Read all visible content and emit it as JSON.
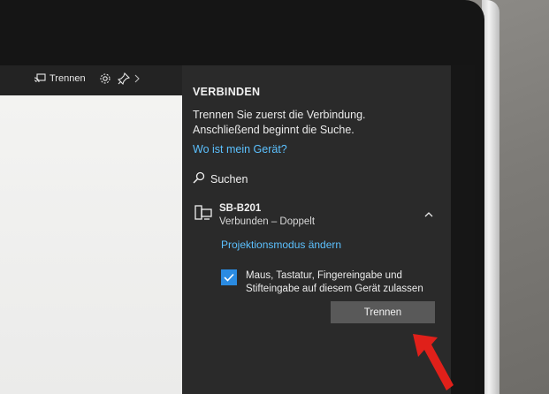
{
  "app_bar": {
    "disconnect_label": "Trennen"
  },
  "connect_pane": {
    "title": "VERBINDEN",
    "message": "Trennen Sie zuerst die Verbindung. Anschließend beginnt die Suche.",
    "where_link": "Wo ist mein Gerät?",
    "search_label": "Suchen",
    "device": {
      "name": "SB-B201",
      "status": "Verbunden – Doppelt"
    },
    "projection_link": "Projektionsmodus ändern",
    "allow_input_checkbox": {
      "label": "Maus, Tastatur, Fingereingabe und Stifteingabe auf diesem Gerät zulassen",
      "checked": true
    },
    "disconnect_button": "Trennen"
  },
  "colors": {
    "accent": "#2a8be2",
    "link": "#5cc1ff",
    "pane_bg": "#2a2a2a",
    "annotation_arrow": "#e0201a"
  },
  "icons": [
    "cast-disconnect-icon",
    "gear-icon",
    "pin-icon",
    "chevron-right-icon",
    "search-icon",
    "display-device-icon",
    "chevron-up-icon",
    "checkmark-icon",
    "red-arrow"
  ]
}
